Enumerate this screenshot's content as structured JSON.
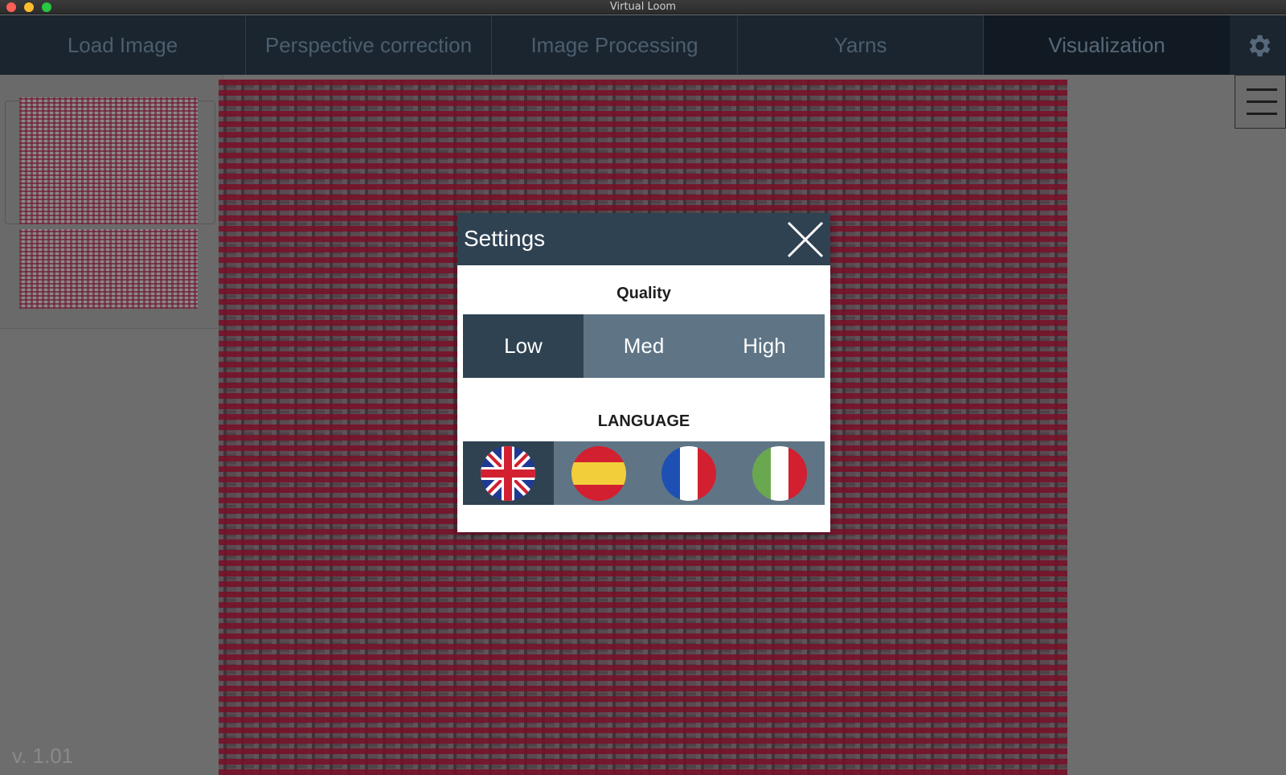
{
  "window": {
    "title": "Virtual Loom"
  },
  "tabs": [
    {
      "label": "Load Image"
    },
    {
      "label": "Perspective correction"
    },
    {
      "label": "Image Processing"
    },
    {
      "label": "Yarns"
    },
    {
      "label": "Visualization",
      "active": true
    }
  ],
  "toolbar": {
    "settings_icon": "gear-icon",
    "menu_icon": "hamburger-menu-icon"
  },
  "footer": {
    "version": "v. 1.01"
  },
  "settings_dialog": {
    "title": "Settings",
    "close_icon": "close-icon",
    "quality": {
      "label": "Quality",
      "options": [
        "Low",
        "Med",
        "High"
      ],
      "selected": "Low"
    },
    "language": {
      "label": "LANGUAGE",
      "options": [
        "uk-flag-icon",
        "spain-flag-icon",
        "france-flag-icon",
        "italy-flag-icon"
      ],
      "selected": "uk-flag-icon"
    }
  },
  "colors": {
    "header_dark": "#1a2530",
    "dialog_header": "#2f4252",
    "segment_bg": "#5f7586",
    "yarn_red": "#7a0f28"
  }
}
